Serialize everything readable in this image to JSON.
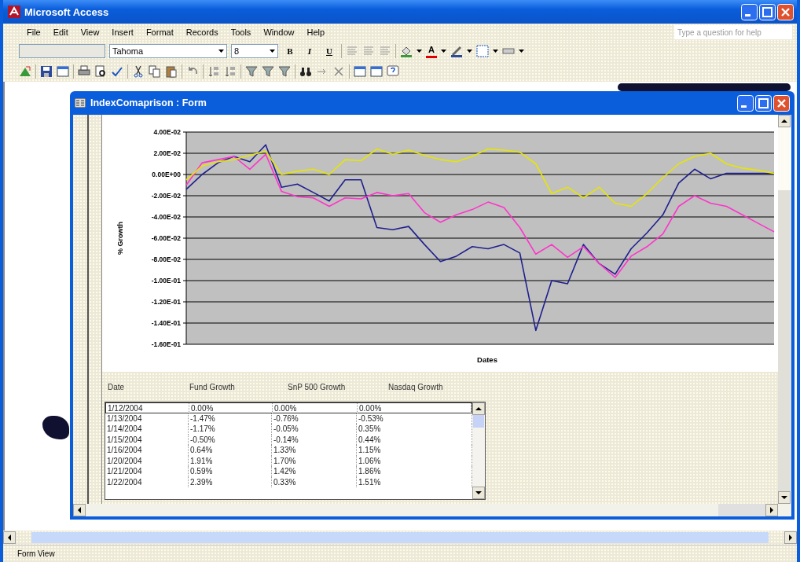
{
  "window": {
    "title": "Microsoft Access"
  },
  "menu": [
    "File",
    "Edit",
    "View",
    "Insert",
    "Format",
    "Records",
    "Tools",
    "Window",
    "Help"
  ],
  "help_box": {
    "placeholder": "Type a question for help"
  },
  "formatting_toolbar": {
    "font": "Tahoma",
    "size": "8",
    "bold": "B",
    "italic": "I",
    "underline": "U",
    "font_color": "A"
  },
  "form": {
    "title": "IndexComaprison : Form",
    "chart": {
      "chart_data": {
        "type": "line",
        "grid": true,
        "xlabel": "Dates",
        "ylabel": "% Growth",
        "ylim": [
          -0.16,
          0.04
        ],
        "yticks": [
          {
            "value": 0.04,
            "label": "4.00E-02"
          },
          {
            "value": 0.02,
            "label": "2.00E-02"
          },
          {
            "value": 0,
            "label": "0.00E+00"
          },
          {
            "value": -0.02,
            "label": "-2.00E-02"
          },
          {
            "value": -0.04,
            "label": "-4.00E-02"
          },
          {
            "value": -0.06,
            "label": "-6.00E-02"
          },
          {
            "value": -0.08,
            "label": "-8.00E-02"
          },
          {
            "value": -0.1,
            "label": "-1.00E-01"
          },
          {
            "value": -0.12,
            "label": "-1.20E-01"
          },
          {
            "value": -0.14,
            "label": "-1.40E-01"
          },
          {
            "value": -0.16,
            "label": "-1.60E-01"
          }
        ],
        "series": [
          {
            "color": "#1f1f8f",
            "values": [
              -0.014,
              0.0,
              0.011,
              0.017,
              0.012,
              0.028,
              -0.012,
              -0.009,
              -0.017,
              -0.025,
              -0.005,
              -0.005,
              -0.05,
              -0.052,
              -0.049,
              -0.066,
              -0.082,
              -0.077,
              -0.068,
              -0.07,
              -0.066,
              -0.074,
              -0.147,
              -0.1,
              -0.103,
              -0.066,
              -0.084,
              -0.094,
              -0.07,
              -0.055,
              -0.038,
              -0.008,
              0.005,
              -0.004,
              0.001,
              0.001,
              0.001,
              0.001
            ]
          },
          {
            "color": "#ff33cc",
            "values": [
              -0.01,
              0.011,
              0.014,
              0.017,
              0.005,
              0.019,
              -0.016,
              -0.021,
              -0.022,
              -0.03,
              -0.022,
              -0.023,
              -0.017,
              -0.02,
              -0.018,
              -0.036,
              -0.045,
              -0.038,
              -0.033,
              -0.026,
              -0.031,
              -0.05,
              -0.075,
              -0.066,
              -0.078,
              -0.068,
              -0.084,
              -0.097,
              -0.077,
              -0.068,
              -0.056,
              -0.03,
              -0.02,
              -0.027,
              -0.03,
              -0.038,
              -0.046,
              -0.054
            ]
          },
          {
            "color": "#e6e600",
            "values": [
              -0.005,
              0.008,
              0.012,
              0.014,
              0.018,
              0.022,
              0.0,
              0.003,
              0.005,
              0.0,
              0.014,
              0.013,
              0.024,
              0.019,
              0.023,
              0.018,
              0.014,
              0.012,
              0.017,
              0.024,
              0.023,
              0.021,
              0.01,
              -0.018,
              -0.012,
              -0.022,
              -0.012,
              -0.027,
              -0.03,
              -0.018,
              -0.003,
              0.01,
              0.017,
              0.02,
              0.01,
              0.006,
              0.004,
              0.001
            ]
          }
        ]
      }
    },
    "columns": [
      "Date",
      "Fund Growth",
      "SnP 500 Growth",
      "Nasdaq Growth"
    ],
    "rows": [
      [
        "1/12/2004",
        "0.00%",
        "0.00%",
        "0.00%"
      ],
      [
        "1/13/2004",
        "-1.47%",
        "-0.76%",
        "-0.53%"
      ],
      [
        "1/14/2004",
        "-1.17%",
        "-0.05%",
        "0.35%"
      ],
      [
        "1/15/2004",
        "-0.50%",
        "-0.14%",
        "0.44%"
      ],
      [
        "1/16/2004",
        "0.64%",
        "1.33%",
        "1.15%"
      ],
      [
        "1/20/2004",
        "1.91%",
        "1.70%",
        "1.06%"
      ],
      [
        "1/21/2004",
        "0.59%",
        "1.42%",
        "1.86%"
      ],
      [
        "1/22/2004",
        "2.39%",
        "0.33%",
        "1.51%"
      ]
    ]
  },
  "status_bar": "Form View"
}
